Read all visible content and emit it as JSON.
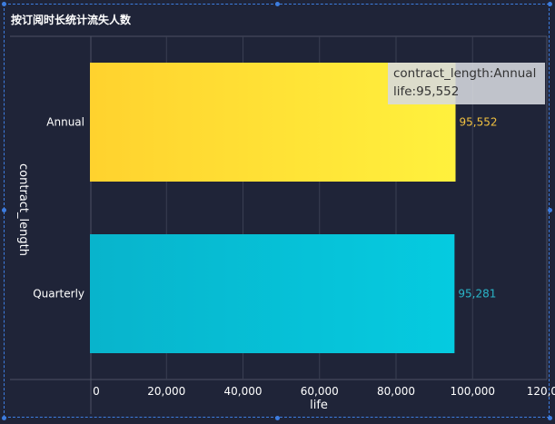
{
  "chart_title": "按订阅时长统计流失人数",
  "accent": "#3d7de0",
  "chart_data": {
    "type": "bar",
    "orientation": "horizontal",
    "title": "按订阅时长统计流失人数",
    "xlabel": "life",
    "ylabel": "contract_length",
    "categories": [
      "Annual",
      "Quarterly"
    ],
    "values": [
      95552,
      95281
    ],
    "value_labels": [
      "95,552",
      "95,281"
    ],
    "colors": [
      "#ffd830",
      "#0ac1d4"
    ],
    "label_colors": [
      "#f0c040",
      "#2ab5c8"
    ],
    "xlim": [
      0,
      120000
    ],
    "xticks": [
      0,
      20000,
      40000,
      60000,
      80000,
      100000,
      120000
    ],
    "xtick_labels": [
      "0",
      "20,000",
      "40,000",
      "60,000",
      "80,000",
      "100,000",
      "120,000"
    ],
    "grid": true
  },
  "tooltip": {
    "line1": "contract_length:Annual",
    "line2": "life:95,552"
  }
}
